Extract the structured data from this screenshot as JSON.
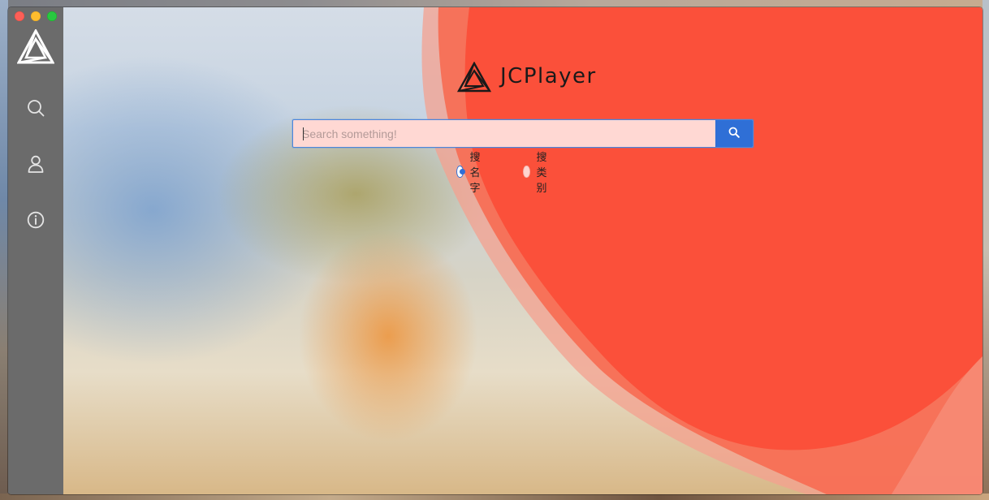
{
  "window": {
    "traffic_lights": [
      "close",
      "minimize",
      "maximize"
    ],
    "colors": {
      "close": "#fc5f57",
      "minimize": "#fdbc2e",
      "maximize": "#28c840"
    }
  },
  "sidebar": {
    "logo_icon": "triangle-logo-icon",
    "items": [
      {
        "icon": "search-icon"
      },
      {
        "icon": "user-icon"
      },
      {
        "icon": "info-icon"
      }
    ],
    "background": "#6b6b6b"
  },
  "brand": {
    "logo_icon": "triangle-logo-icon",
    "title": "JCPlayer"
  },
  "search": {
    "placeholder": "Search something!",
    "value": "",
    "button_icon": "search-icon"
  },
  "search_mode": {
    "options": [
      {
        "label": "搜名字",
        "checked": true
      },
      {
        "label": "搜类别",
        "checked": false
      }
    ]
  },
  "colors": {
    "accent": "#2f6fd6",
    "wave": "#fb503a",
    "input_background": "#ffd8d3"
  }
}
